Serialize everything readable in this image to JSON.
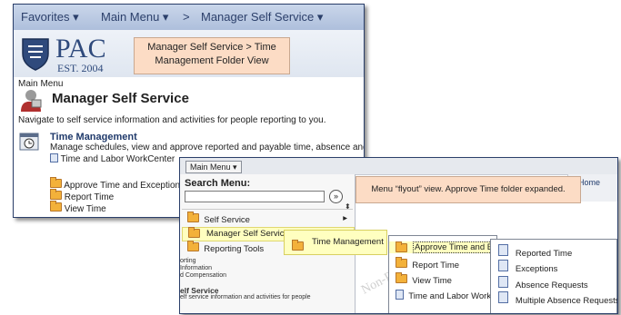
{
  "panel1": {
    "nav": {
      "favorites": "Favorites",
      "main_menu": "Main Menu",
      "sep": ">",
      "mss": "Manager Self Service"
    },
    "logo": {
      "name": "PAC",
      "est": "EST. 2004"
    },
    "callout": "Manager Self Service > Time Management Folder View",
    "breadcrumb": "Main Menu",
    "page_title": "Manager Self Service",
    "page_desc": "Navigate to self service information and activities for people reporting to you.",
    "tm_title": "Time Management",
    "tm_desc": "Manage schedules, view and approve reported and payable time, absence and c",
    "tm_workcenter": "Time and Labor WorkCenter",
    "folders": [
      "Approve Time and Exceptions",
      "Report Time",
      "View Time"
    ]
  },
  "panel2": {
    "main_menu_btn": "Main Menu",
    "search_label": "Search Menu:",
    "search_value": "",
    "home_link": "Home",
    "callout": "Menu “flyout” view.  Approve Time folder expanded.",
    "menu": [
      "Self Service",
      "Manager Self Service",
      "Reporting Tools"
    ],
    "tm_flyout": "Time Management",
    "tm_items": [
      "Approve Time and Exce",
      "Report Time",
      "View Time",
      "Time and Labor WorkCe"
    ],
    "approve_items": [
      "Reported Time",
      "Exceptions",
      "Absence Requests",
      "Multiple Absence Requests"
    ],
    "bg_frag": [
      "orting",
      "Information",
      "d Compensation"
    ],
    "bg_heading": "elf Service",
    "bg_desc": "elf service information and activities for people",
    "watermark": "Non-Pro"
  },
  "colors": {
    "nav_blue": "#aebfdc",
    "callout": "#fcdcc5",
    "highlight": "#ffffc0",
    "title_blue": "#203a6b",
    "folder": "#f3b13a"
  }
}
